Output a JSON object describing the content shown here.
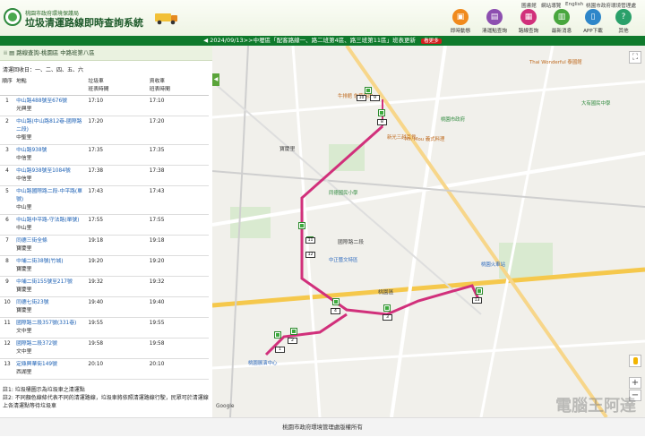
{
  "header": {
    "org": "桃園市政府環境保護局",
    "site": "垃圾清運路線即時查詢系統",
    "top_links": [
      "圖書館",
      "網站導覽",
      "English",
      "桃園市政府環境管理處"
    ],
    "nav": [
      {
        "label": "即時動態",
        "color": "#f08a1d",
        "icon": "truck-icon"
      },
      {
        "label": "清運點查詢",
        "color": "#8d4fb0",
        "icon": "calendar-icon"
      },
      {
        "label": "路線查詢",
        "color": "#d1307b",
        "icon": "map-route-icon"
      },
      {
        "label": "最新消息",
        "color": "#48a63e",
        "icon": "news-icon"
      },
      {
        "label": "APP下載",
        "color": "#2e86c9",
        "icon": "phone-icon"
      },
      {
        "label": "其他",
        "color": "#2aa06a",
        "icon": "question-icon"
      }
    ]
  },
  "banner": {
    "text": "2024/09/13>>中壢區「配客路線一、路二班第4區、路三班第11區」班表更新",
    "more": "看更多"
  },
  "panel": {
    "title": "路線查詢-桃園區 中路班第八區",
    "days": "清運回收日：一、二、四、五、六",
    "columns": [
      "順序",
      "地點",
      "垃圾車\n班表時間",
      "資收車\n班表時間"
    ],
    "rows": [
      {
        "no": "1",
        "place": "中山路488號至676號",
        "area": "光興里",
        "t1": "17:10",
        "t2": "17:10"
      },
      {
        "no": "2",
        "place": "中山路(中山路812巷-國際路二段)",
        "area": "中聖里",
        "t1": "17:20",
        "t2": "17:20"
      },
      {
        "no": "3",
        "place": "中山路938號",
        "area": "中信里",
        "t1": "17:35",
        "t2": "17:35"
      },
      {
        "no": "4",
        "place": "中山路938號至1084號",
        "area": "中信里",
        "t1": "17:38",
        "t2": "17:38"
      },
      {
        "no": "5",
        "place": "中山路國際路二段-中平路(單號)",
        "area": "中山里",
        "t1": "17:43",
        "t2": "17:43"
      },
      {
        "no": "6",
        "place": "中山路中平路-守法路(單號)",
        "area": "中山里",
        "t1": "17:55",
        "t2": "17:55"
      },
      {
        "no": "7",
        "place": "同德三街全條",
        "area": "寶慶里",
        "t1": "19:18",
        "t2": "19:18"
      },
      {
        "no": "8",
        "place": "中埔二街38號(竹城)",
        "area": "寶慶里",
        "t1": "19:20",
        "t2": "19:20"
      },
      {
        "no": "9",
        "place": "中埔二街155號至217號",
        "area": "寶慶里",
        "t1": "19:32",
        "t2": "19:32"
      },
      {
        "no": "10",
        "place": "同德七街23號",
        "area": "寶慶里",
        "t1": "19:40",
        "t2": "19:40"
      },
      {
        "no": "11",
        "place": "國際路二段357號(331巷)",
        "area": "文中里",
        "t1": "19:55",
        "t2": "19:55"
      },
      {
        "no": "12",
        "place": "國際路二段372號",
        "area": "文中里",
        "t1": "19:58",
        "t2": "19:58"
      },
      {
        "no": "13",
        "place": "定鼎興華街149號",
        "area": "西湖里",
        "t1": "20:10",
        "t2": "20:10"
      }
    ],
    "notes": [
      "註1: 垃圾桶圖示為垃圾車之清運點",
      "註2: 不同顏色線條代表不同的清運路線，垃圾車將依照清運路線行駛，民眾可於清運線上各清運點等待垃圾車"
    ]
  },
  "map": {
    "place_labels": [
      {
        "t": "桃園區",
        "cls": "d"
      },
      {
        "t": "桃園市政府",
        "cls": "g"
      },
      {
        "t": "中正藝文特區",
        "cls": "b"
      },
      {
        "t": "Thai Wonderful 泰國館",
        "cls": ""
      },
      {
        "t": "桃園火車站",
        "cls": "b"
      },
      {
        "t": "牛排館 佐藤燒肉",
        "cls": ""
      },
      {
        "t": "同德國民小學",
        "cls": "g"
      },
      {
        "t": "寶慶里",
        "cls": "d"
      },
      {
        "t": "新光三越百貨",
        "cls": ""
      },
      {
        "t": "桃園展演中心",
        "cls": "b"
      },
      {
        "t": "Mr. Mou 義式料理",
        "cls": ""
      },
      {
        "t": "國際路二段",
        "cls": "d"
      },
      {
        "t": "大有國民中學",
        "cls": "g"
      },
      {
        "t": "Google",
        "cls": "d"
      }
    ],
    "route_labels": [
      "10",
      "9",
      "8",
      "11",
      "12",
      "13",
      "1",
      "2",
      "3",
      "4",
      "5",
      "6",
      "7"
    ]
  },
  "footer": {
    "text": "桃園市政府環境管理處版權所有"
  },
  "watermark": "電腦王阿達"
}
